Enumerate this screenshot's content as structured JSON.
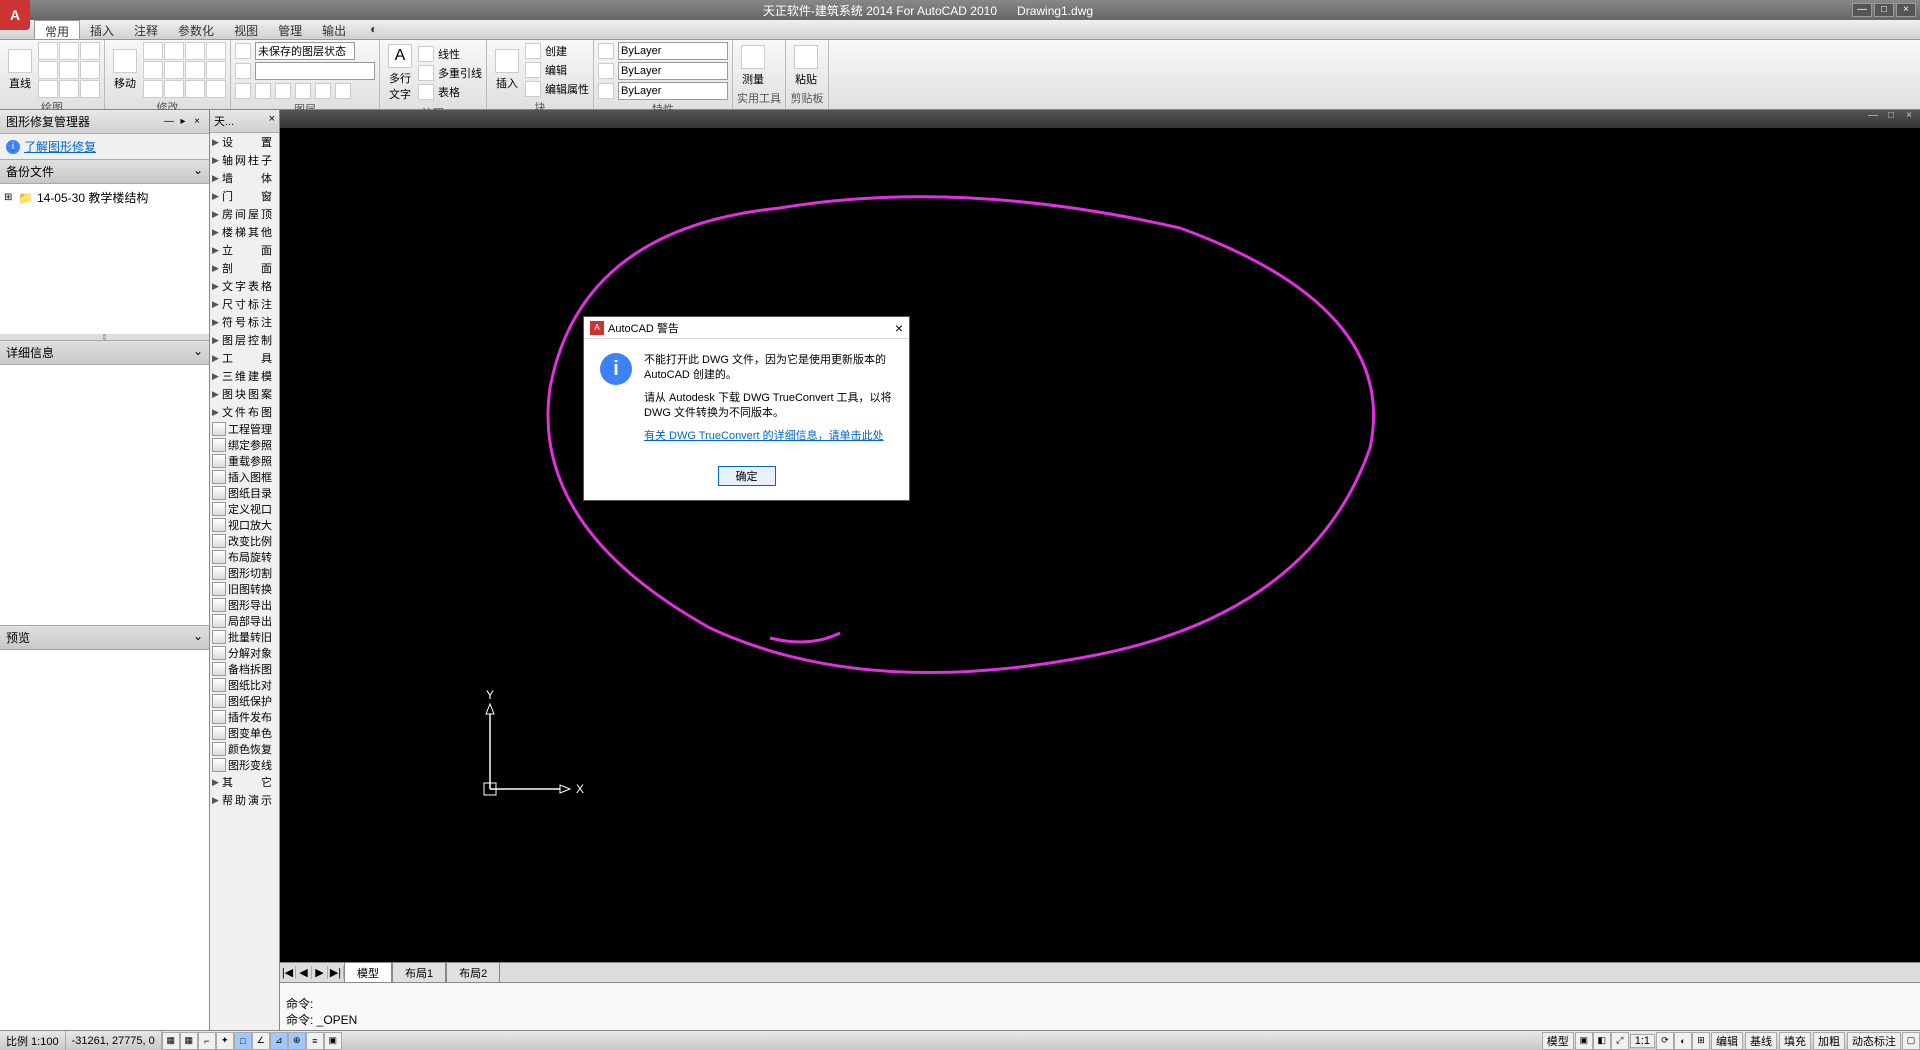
{
  "title": {
    "app": "天正软件-建筑系统 2014  For AutoCAD 2010",
    "doc": "Drawing1.dwg"
  },
  "app_logo": "A",
  "menu_tabs": [
    "常用",
    "插入",
    "注释",
    "参数化",
    "视图",
    "管理",
    "输出"
  ],
  "active_tab": 0,
  "ribbon": {
    "panels": {
      "draw": {
        "label": "绘图",
        "big": "直线"
      },
      "modify": {
        "label": "修改",
        "big": "移动"
      },
      "layers": {
        "label": "图层",
        "combo": "未保存的图层状态"
      },
      "annot": {
        "label": "注释",
        "big": "多行\n文字",
        "rows": [
          "线性",
          "多重引线",
          "表格"
        ]
      },
      "block": {
        "label": "块",
        "big": "插入",
        "rows": [
          "创建",
          "编辑",
          "编辑属性"
        ]
      },
      "props": {
        "label": "特性",
        "rows": [
          "ByLayer",
          "ByLayer",
          "ByLayer"
        ]
      },
      "util": {
        "label": "实用工具",
        "big": "测量"
      },
      "clip": {
        "label": "剪贴板",
        "big": "粘贴"
      }
    }
  },
  "left_panel": {
    "title": "图形修复管理器",
    "link": "了解图形修复",
    "backup_header": "备份文件",
    "tree_item": "14-05-30 教学楼结构",
    "detail_header": "详细信息",
    "preview_header": "预览"
  },
  "tz_panel": {
    "title": "天...",
    "cats": [
      "设　　置",
      "轴网柱子",
      "墙　　体",
      "门　　窗",
      "房间屋顶",
      "楼梯其他",
      "立　　面",
      "剖　　面",
      "文字表格",
      "尺寸标注",
      "符号标注",
      "图层控制",
      "工　　具",
      "三维建模",
      "图块图案",
      "文件布图"
    ],
    "tools": [
      "工程管理",
      "绑定参照",
      "重载参照",
      "插入图框",
      "图纸目录",
      "定义视口",
      "视口放大",
      "改变比例",
      "布局旋转",
      "图形切割",
      "旧图转换",
      "图形导出",
      "局部导出",
      "批量转旧",
      "分解对象",
      "备档拆图",
      "图纸比对",
      "图纸保护",
      "插件发布",
      "图变单色",
      "颜色恢复",
      "图形变线"
    ],
    "cats2": [
      "其　　它",
      "帮助演示"
    ]
  },
  "layout_tabs": {
    "active": "模型",
    "others": [
      "布局1",
      "布局2"
    ]
  },
  "cmd": {
    "l1": "命令:",
    "l2": "命令: _OPEN"
  },
  "status": {
    "scale": "比例 1:100",
    "coords": "-31261, 27775, 0",
    "right_model": "模型",
    "right_scale": "1:1",
    "right_btns": [
      "捕捉",
      "栅格",
      "正交",
      "极轴",
      "对象捕捉",
      "对象追踪",
      "DUCS",
      "DYN",
      "线宽",
      "QP"
    ],
    "right_text_btns": [
      "编辑",
      "基线",
      "填充",
      "加粗",
      "动态标注"
    ]
  },
  "dialog": {
    "title": "AutoCAD 警告",
    "msg1": "不能打开此 DWG 文件，因为它是使用更新版本的 AutoCAD 创建的。",
    "msg2": "请从 Autodesk 下载 DWG TrueConvert 工具，以将 DWG 文件转换为不同版本。",
    "link": "有关 DWG TrueConvert 的详细信息，请单击此处",
    "ok": "确定"
  },
  "ucs": {
    "x": "X",
    "y": "Y"
  }
}
